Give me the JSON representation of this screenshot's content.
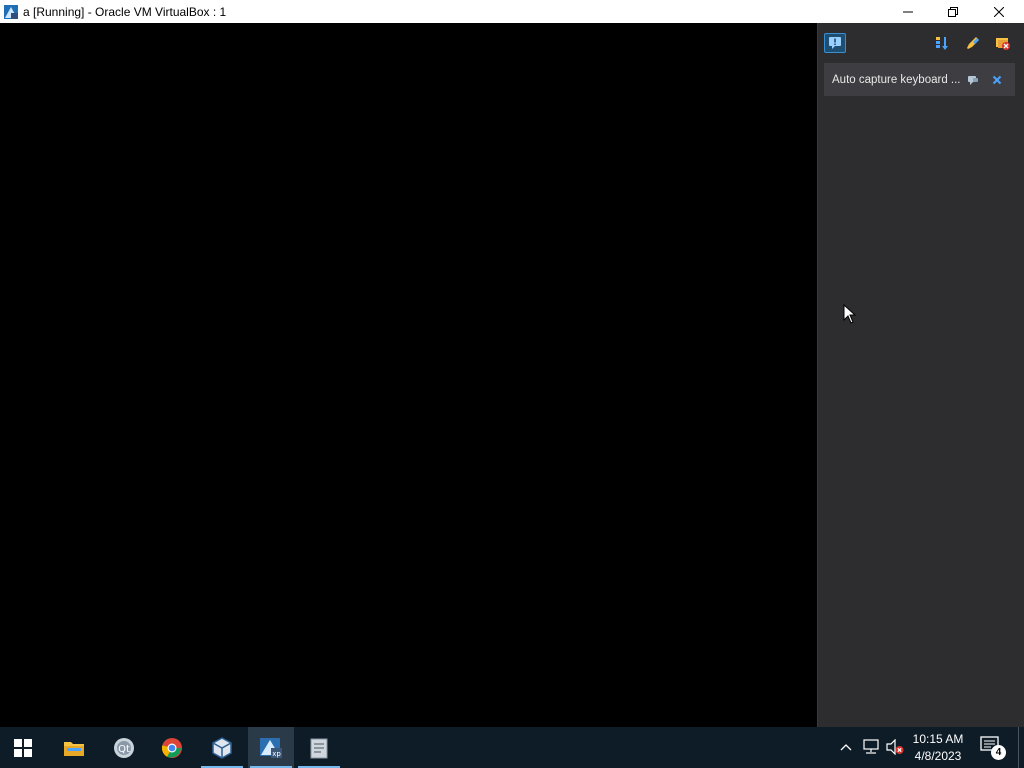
{
  "window": {
    "title": "a [Running] - Oracle VM VirtualBox : 1",
    "icon": "virtualbox-xp-icon",
    "controls": {
      "minimize": "minimize-icon",
      "maximize": "restore-icon",
      "close": "close-icon"
    }
  },
  "notification_center": {
    "toolbar": [
      {
        "name": "notifications-icon"
      },
      {
        "name": "sort-icon"
      },
      {
        "name": "keep-finished-icon"
      },
      {
        "name": "dismiss-all-icon"
      }
    ],
    "items": [
      {
        "text": "Auto capture keyboard ..."
      }
    ]
  },
  "taskbar": {
    "pinned": [
      "windows-start-icon",
      "file-explorer-icon",
      "qt-creator-icon",
      "chrome-icon",
      "virtualbox-icon",
      "virtualbox-vm-xp-icon",
      "document-app-icon"
    ],
    "clock": {
      "time": "10:15 AM",
      "date": "4/8/2023"
    },
    "notifications_count": "4"
  },
  "colors": {
    "panel_bg": "#2d2d30",
    "taskbar_bg": "#0e1c27",
    "accent": "#3a8fd1"
  }
}
